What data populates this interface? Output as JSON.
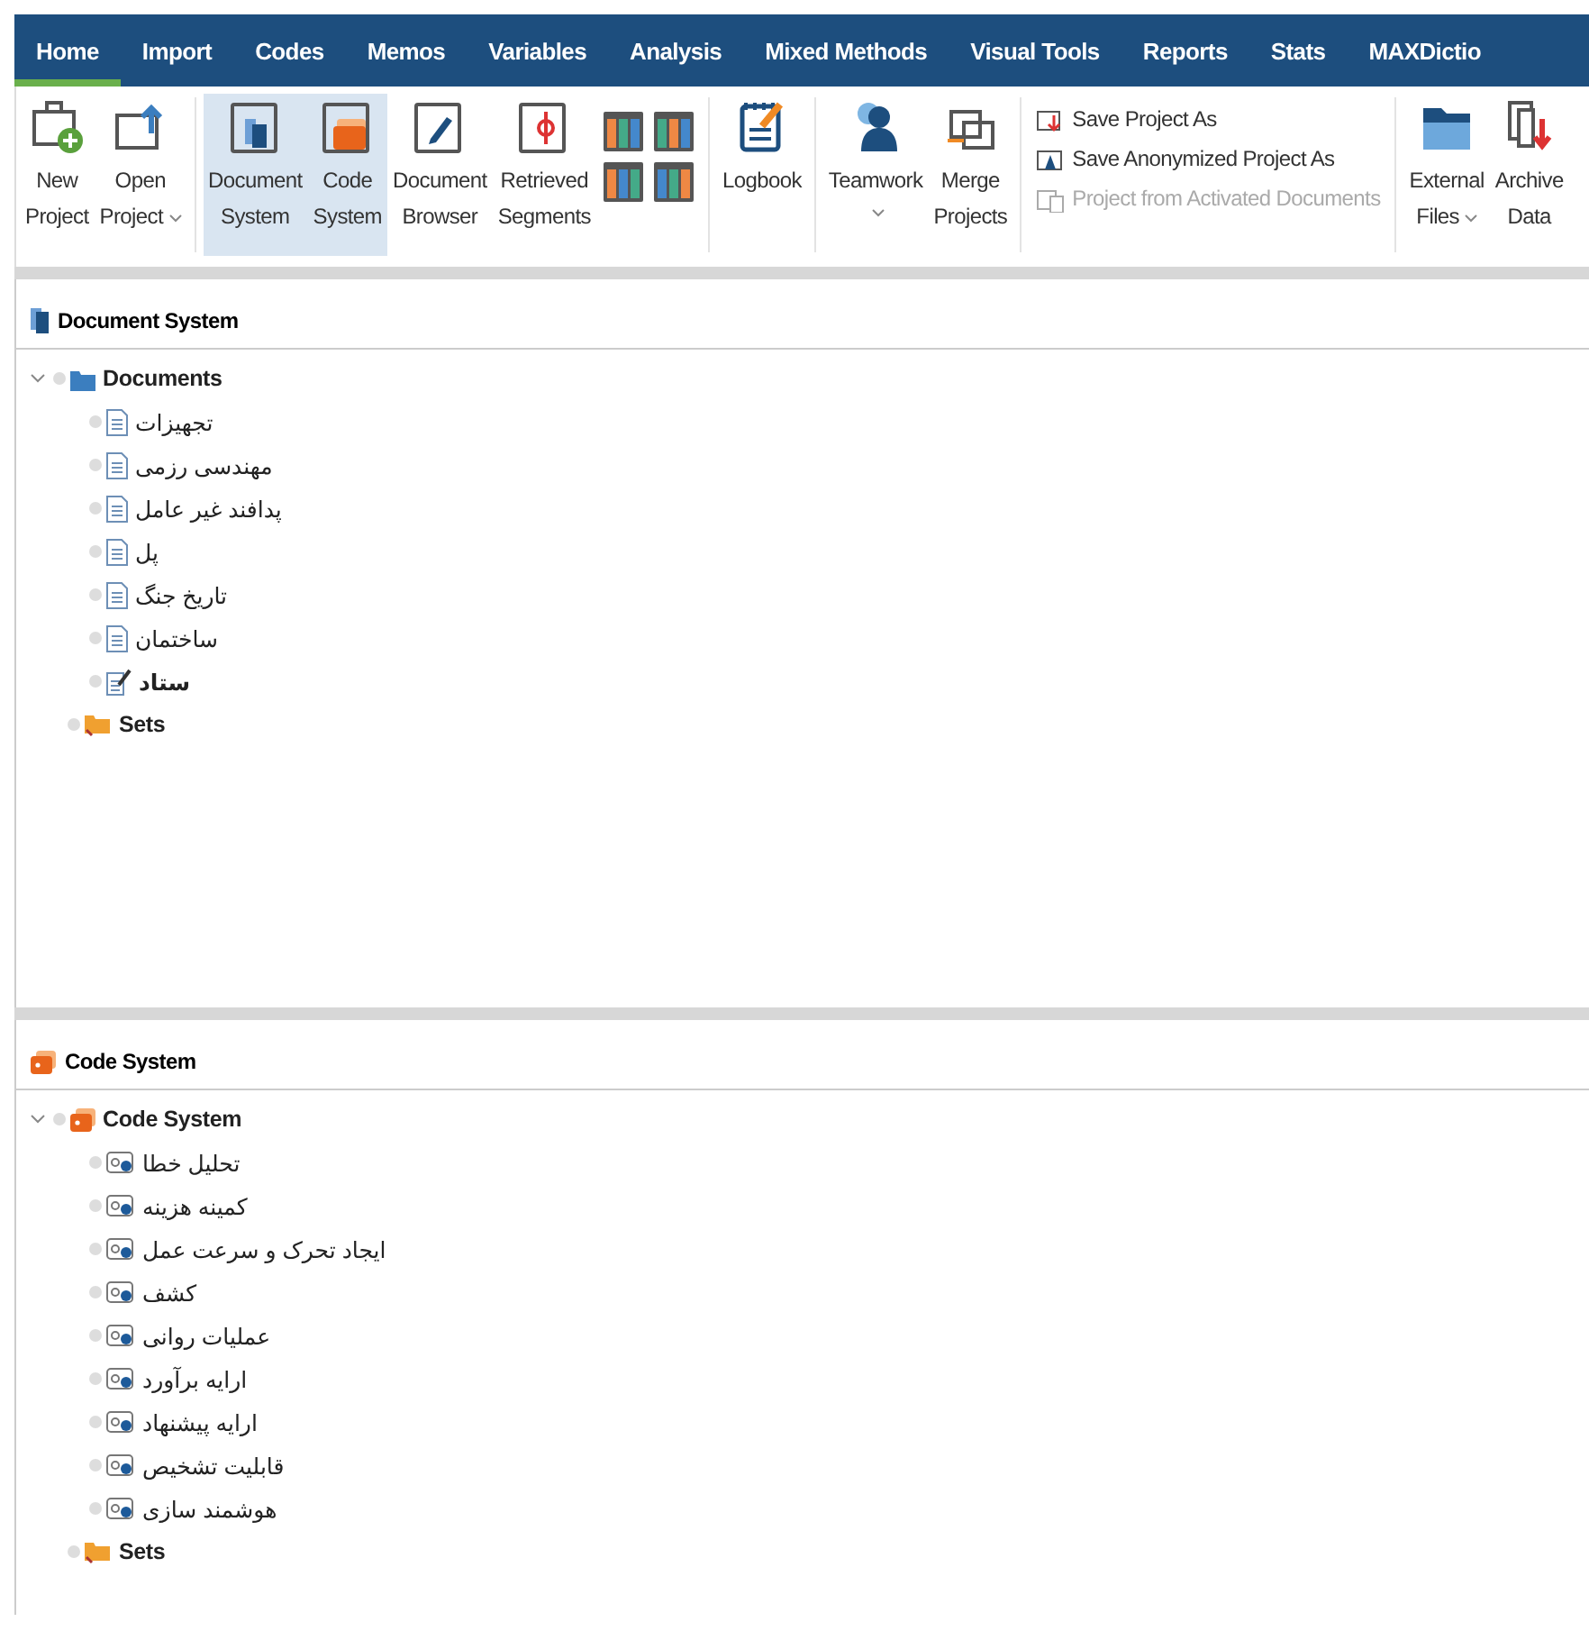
{
  "tabs": [
    {
      "label": "Home",
      "selected": true
    },
    {
      "label": "Import",
      "selected": false
    },
    {
      "label": "Codes",
      "selected": false
    },
    {
      "label": "Memos",
      "selected": false
    },
    {
      "label": "Variables",
      "selected": false
    },
    {
      "label": "Analysis",
      "selected": false
    },
    {
      "label": "Mixed Methods",
      "selected": false
    },
    {
      "label": "Visual Tools",
      "selected": false
    },
    {
      "label": "Reports",
      "selected": false
    },
    {
      "label": "Stats",
      "selected": false
    },
    {
      "label": "MAXDictio",
      "selected": false
    }
  ],
  "ribbon_groups": [
    {
      "items": [
        {
          "kind": "button",
          "label": [
            "New",
            "Project"
          ],
          "selected": false,
          "dropdown": false
        },
        {
          "kind": "button",
          "label": [
            "Open",
            "Project"
          ],
          "selected": false,
          "dropdown": true
        }
      ]
    },
    {
      "items": [
        {
          "kind": "button",
          "label": [
            "Document",
            "System"
          ],
          "selected": true,
          "dropdown": false
        },
        {
          "kind": "button",
          "label": [
            "Code",
            "System"
          ],
          "selected": true,
          "dropdown": false
        },
        {
          "kind": "button",
          "label": [
            "Document",
            "Browser"
          ],
          "selected": false,
          "dropdown": false
        },
        {
          "kind": "button",
          "label": [
            "Retrieved",
            "Segments"
          ],
          "selected": false,
          "dropdown": false
        },
        {
          "kind": "layouts"
        }
      ]
    },
    {
      "items": [
        {
          "kind": "button",
          "label": [
            "Logbook"
          ],
          "selected": false,
          "dropdown": false
        }
      ]
    },
    {
      "items": [
        {
          "kind": "button",
          "label": [
            "Teamwork"
          ],
          "selected": false,
          "dropdown": true
        },
        {
          "kind": "button",
          "label": [
            "Merge",
            "Projects"
          ],
          "selected": false,
          "dropdown": false
        }
      ]
    },
    {
      "items": [
        {
          "kind": "stack",
          "items": [
            {
              "label": "Save Project As",
              "disabled": false
            },
            {
              "label": "Save Anonymized Project As",
              "disabled": false
            },
            {
              "label": "Project from Activated Documents",
              "disabled": true
            }
          ]
        }
      ]
    },
    {
      "items": [
        {
          "kind": "button",
          "label": [
            "External",
            "Files"
          ],
          "selected": false,
          "dropdown": true
        },
        {
          "kind": "button",
          "label": [
            "Archive",
            "Data"
          ],
          "selected": false,
          "dropdown": false
        }
      ]
    }
  ],
  "panels": [
    {
      "kind": "documents",
      "title": "Document System",
      "root": {
        "label": "Documents",
        "expanded": true,
        "children": [
          {
            "label": "تجهیزات",
            "kind": "document",
            "bold": false
          },
          {
            "label": "مهندسی رزمی",
            "kind": "document",
            "bold": false
          },
          {
            "label": "پدافند غیر عامل",
            "kind": "document",
            "bold": false
          },
          {
            "label": "پل",
            "kind": "document",
            "bold": false
          },
          {
            "label": "تاریخ جنگ",
            "kind": "document",
            "bold": false
          },
          {
            "label": "ساختمان",
            "kind": "document",
            "bold": false
          },
          {
            "label": "ستاد",
            "kind": "memo-document",
            "bold": true
          }
        ]
      },
      "sets": "Sets"
    },
    {
      "kind": "codes",
      "title": "Code System",
      "root": {
        "label": "Code System",
        "expanded": true,
        "children": [
          {
            "label": "تحلیل خطا",
            "kind": "code",
            "bold": false
          },
          {
            "label": "کمینه هزینه",
            "kind": "code",
            "bold": false
          },
          {
            "label": "ایجاد تحرک و سرعت عمل",
            "kind": "code",
            "bold": false
          },
          {
            "label": "کشف",
            "kind": "code",
            "bold": false
          },
          {
            "label": "عملیات روانی",
            "kind": "code",
            "bold": false
          },
          {
            "label": "ارایه برآورد",
            "kind": "code",
            "bold": false
          },
          {
            "label": "ارایه پیشنهاد",
            "kind": "code",
            "bold": false
          },
          {
            "label": "قابلیت تشخیص",
            "kind": "code",
            "bold": false
          },
          {
            "label": "هوشمند سازی",
            "kind": "code",
            "bold": false
          }
        ]
      },
      "sets": "Sets"
    }
  ]
}
